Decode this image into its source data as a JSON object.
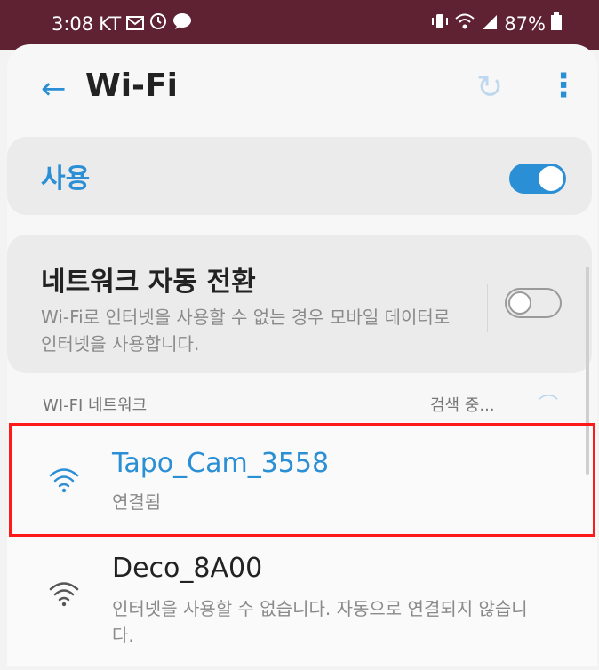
{
  "status_bar": {
    "time": "3:08",
    "carrier": "KT",
    "battery": "87%",
    "icons_left": [
      "message-icon",
      "alarm-icon",
      "chat-icon"
    ],
    "icons_right": [
      "vibrate-icon",
      "wifi-signal-icon",
      "cell-signal-icon",
      "battery-icon"
    ]
  },
  "header": {
    "back_icon": "←",
    "title": "Wi-Fi",
    "refresh_icon": "↻",
    "more_icon": "⋮"
  },
  "use_toggle": {
    "label": "사용",
    "state": "on"
  },
  "network_switch": {
    "title": "네트워크 자동 전환",
    "description": "Wi-Fi로 인터넷을 사용할 수 없는 경우 모바일 데이터로 인터넷을 사용합니다.",
    "state": "off"
  },
  "networks_section": {
    "header": "WI-FI 네트워크",
    "scanning": "검색 중...",
    "items": [
      {
        "name": "Tapo_Cam_3558",
        "status": "연결됨",
        "connected": true
      },
      {
        "name": "Deco_8A00",
        "status": "인터넷을 사용할 수 없습니다. 자동으로 연결되지 않습니다.",
        "connected": false
      }
    ]
  },
  "colors": {
    "accent": "#2b8fd6",
    "status_bar_bg": "#5e2233",
    "highlight": "#ff1a1a"
  }
}
